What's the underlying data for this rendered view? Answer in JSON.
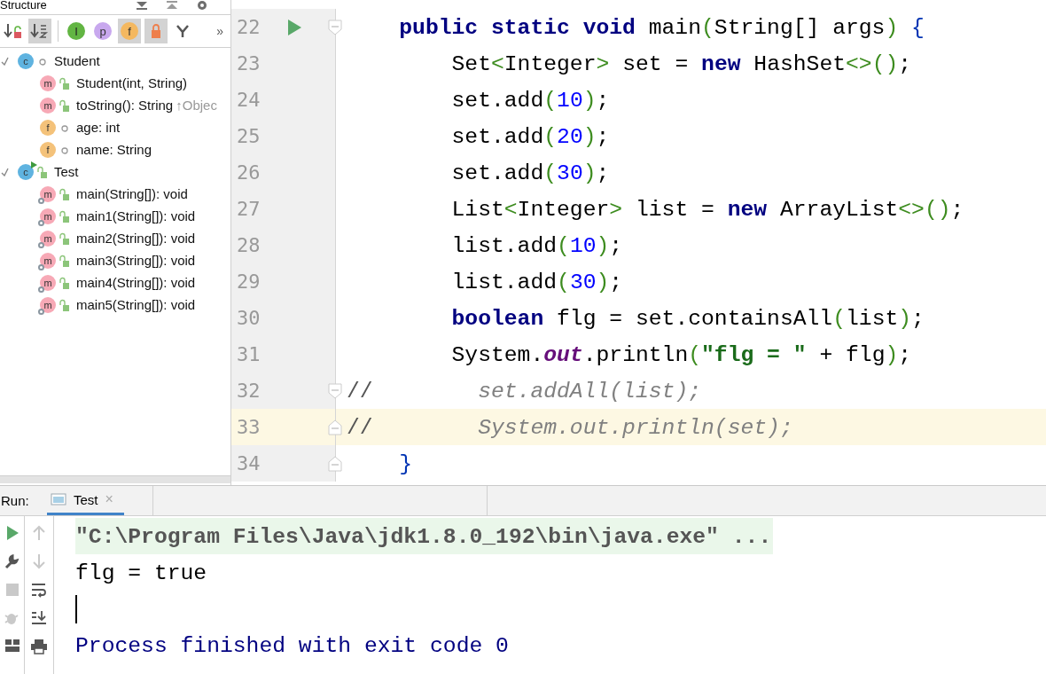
{
  "structure": {
    "title": "Structure",
    "toolbar": [
      {
        "kind": "sort-visibility",
        "on": false
      },
      {
        "kind": "sort-alpha",
        "on": true
      },
      {
        "kind": "divider"
      },
      {
        "kind": "inherited",
        "letter": "I",
        "on": false
      },
      {
        "kind": "properties",
        "letter": "p",
        "on": false
      },
      {
        "kind": "fields",
        "letter": "f",
        "on": true
      },
      {
        "kind": "non-public",
        "on": true
      },
      {
        "kind": "anonymous",
        "on": false
      }
    ],
    "overflow": "»",
    "tree": [
      {
        "name": "Student",
        "kind": "class",
        "letter": "c",
        "public": false,
        "runnable": false,
        "expanded": true,
        "children": [
          {
            "name": "Student(int, String)",
            "kind": "method",
            "letter": "m",
            "public": true,
            "static": false
          },
          {
            "name": "toString(): String",
            "kind": "method",
            "letter": "m",
            "public": true,
            "static": false,
            "hint": "↑Objec"
          },
          {
            "name": "age: int",
            "kind": "field",
            "letter": "f",
            "public": false,
            "static": false
          },
          {
            "name": "name: String",
            "kind": "field",
            "letter": "f",
            "public": false,
            "static": false
          }
        ]
      },
      {
        "name": "Test",
        "kind": "class",
        "letter": "c",
        "public": true,
        "runnable": true,
        "expanded": true,
        "children": [
          {
            "name": "main(String[]): void",
            "kind": "method",
            "letter": "m",
            "public": true,
            "static": true
          },
          {
            "name": "main1(String[]): void",
            "kind": "method",
            "letter": "m",
            "public": true,
            "static": true
          },
          {
            "name": "main2(String[]): void",
            "kind": "method",
            "letter": "m",
            "public": true,
            "static": true
          },
          {
            "name": "main3(String[]): void",
            "kind": "method",
            "letter": "m",
            "public": true,
            "static": true
          },
          {
            "name": "main4(String[]): void",
            "kind": "method",
            "letter": "m",
            "public": true,
            "static": true
          },
          {
            "name": "main5(String[]): void",
            "kind": "method",
            "letter": "m",
            "public": true,
            "static": true
          }
        ]
      }
    ]
  },
  "editor": {
    "lines": [
      {
        "number": "22",
        "run": true,
        "fold_start": true,
        "fold_end": false,
        "current": false,
        "kind": "member",
        "tokens": [
          {
            "text": "public static void",
            "kind": "keyword"
          },
          {
            "text": " main",
            "kind": "plain"
          },
          {
            "text": "(",
            "kind": "paren"
          },
          {
            "text": "String[] args",
            "kind": "plain"
          },
          {
            "text": ")",
            "kind": "paren"
          },
          {
            "text": " {",
            "kind": "brace"
          }
        ]
      },
      {
        "number": "23",
        "run": false,
        "fold_start": false,
        "fold_end": false,
        "current": false,
        "kind": "statement",
        "tokens": [
          {
            "text": "Set",
            "kind": "plain"
          },
          {
            "text": "<",
            "kind": "paren"
          },
          {
            "text": "Integer",
            "kind": "plain"
          },
          {
            "text": ">",
            "kind": "paren"
          },
          {
            "text": " set = ",
            "kind": "plain"
          },
          {
            "text": "new",
            "kind": "keyword"
          },
          {
            "text": " HashSet",
            "kind": "plain"
          },
          {
            "text": "<>()",
            "kind": "paren"
          },
          {
            "text": ";",
            "kind": "plain"
          }
        ]
      },
      {
        "number": "24",
        "run": false,
        "fold_start": false,
        "fold_end": false,
        "current": false,
        "kind": "statement",
        "tokens": [
          {
            "text": "set.add",
            "kind": "plain"
          },
          {
            "text": "(",
            "kind": "paren"
          },
          {
            "text": "10",
            "kind": "number"
          },
          {
            "text": ")",
            "kind": "paren"
          },
          {
            "text": ";",
            "kind": "plain"
          }
        ]
      },
      {
        "number": "25",
        "run": false,
        "fold_start": false,
        "fold_end": false,
        "current": false,
        "kind": "statement",
        "tokens": [
          {
            "text": "set.add",
            "kind": "plain"
          },
          {
            "text": "(",
            "kind": "paren"
          },
          {
            "text": "20",
            "kind": "number"
          },
          {
            "text": ")",
            "kind": "paren"
          },
          {
            "text": ";",
            "kind": "plain"
          }
        ]
      },
      {
        "number": "26",
        "run": false,
        "fold_start": false,
        "fold_end": false,
        "current": false,
        "kind": "statement",
        "tokens": [
          {
            "text": "set.add",
            "kind": "plain"
          },
          {
            "text": "(",
            "kind": "paren"
          },
          {
            "text": "30",
            "kind": "number"
          },
          {
            "text": ")",
            "kind": "paren"
          },
          {
            "text": ";",
            "kind": "plain"
          }
        ]
      },
      {
        "number": "27",
        "run": false,
        "fold_start": false,
        "fold_end": false,
        "current": false,
        "kind": "statement",
        "tokens": [
          {
            "text": "List",
            "kind": "plain"
          },
          {
            "text": "<",
            "kind": "paren"
          },
          {
            "text": "Integer",
            "kind": "plain"
          },
          {
            "text": ">",
            "kind": "paren"
          },
          {
            "text": " list = ",
            "kind": "plain"
          },
          {
            "text": "new",
            "kind": "keyword"
          },
          {
            "text": " ArrayList",
            "kind": "plain"
          },
          {
            "text": "<>()",
            "kind": "paren"
          },
          {
            "text": ";",
            "kind": "plain"
          }
        ]
      },
      {
        "number": "28",
        "run": false,
        "fold_start": false,
        "fold_end": false,
        "current": false,
        "kind": "statement",
        "tokens": [
          {
            "text": "list.add",
            "kind": "plain"
          },
          {
            "text": "(",
            "kind": "paren"
          },
          {
            "text": "10",
            "kind": "number"
          },
          {
            "text": ")",
            "kind": "paren"
          },
          {
            "text": ";",
            "kind": "plain"
          }
        ]
      },
      {
        "number": "29",
        "run": false,
        "fold_start": false,
        "fold_end": false,
        "current": false,
        "kind": "statement",
        "tokens": [
          {
            "text": "list.add",
            "kind": "plain"
          },
          {
            "text": "(",
            "kind": "paren"
          },
          {
            "text": "30",
            "kind": "number"
          },
          {
            "text": ")",
            "kind": "paren"
          },
          {
            "text": ";",
            "kind": "plain"
          }
        ]
      },
      {
        "number": "30",
        "run": false,
        "fold_start": false,
        "fold_end": false,
        "current": false,
        "kind": "statement",
        "tokens": [
          {
            "text": "boolean",
            "kind": "keyword"
          },
          {
            "text": " flg = set.containsAll",
            "kind": "plain"
          },
          {
            "text": "(",
            "kind": "paren"
          },
          {
            "text": "list",
            "kind": "plain"
          },
          {
            "text": ")",
            "kind": "paren"
          },
          {
            "text": ";",
            "kind": "plain"
          }
        ]
      },
      {
        "number": "31",
        "run": false,
        "fold_start": false,
        "fold_end": false,
        "current": false,
        "kind": "statement",
        "tokens": [
          {
            "text": "System.",
            "kind": "plain"
          },
          {
            "text": "out",
            "kind": "field"
          },
          {
            "text": ".println",
            "kind": "plain"
          },
          {
            "text": "(",
            "kind": "paren"
          },
          {
            "text": "\"flg = \"",
            "kind": "string"
          },
          {
            "text": " + flg",
            "kind": "plain"
          },
          {
            "text": ")",
            "kind": "paren"
          },
          {
            "text": ";",
            "kind": "plain"
          }
        ]
      },
      {
        "number": "32",
        "run": false,
        "fold_start": true,
        "fold_end": false,
        "current": false,
        "kind": "comment",
        "tokens": [
          {
            "text": "//",
            "kind": "comment-mark"
          },
          {
            "text": "        set.addAll(list);",
            "kind": "comment"
          }
        ]
      },
      {
        "number": "33",
        "run": false,
        "fold_start": false,
        "fold_end": true,
        "current": true,
        "kind": "comment",
        "tokens": [
          {
            "text": "//",
            "kind": "comment-mark"
          },
          {
            "text": "        System.out.println(set);",
            "kind": "comment"
          }
        ]
      },
      {
        "number": "34",
        "run": false,
        "fold_start": false,
        "fold_end": true,
        "current": false,
        "kind": "member",
        "tokens": [
          {
            "text": "}",
            "kind": "brace"
          }
        ]
      }
    ]
  },
  "run_panel": {
    "label": "Run:",
    "tabs": [
      {
        "label": "Test",
        "selected": true,
        "close": "×"
      }
    ],
    "console": [
      {
        "kind": "command",
        "text": "\"C:\\Program Files\\Java\\jdk1.8.0_192\\bin\\java.exe\" ..."
      },
      {
        "kind": "output",
        "text": "flg = true"
      },
      {
        "kind": "caret"
      },
      {
        "kind": "exit",
        "text": "Process finished with exit code 0"
      }
    ]
  }
}
